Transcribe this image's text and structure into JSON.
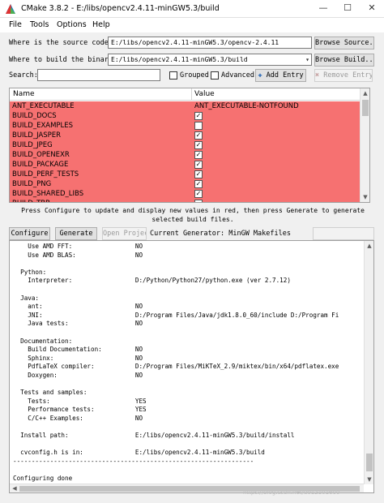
{
  "window": {
    "title": "CMake 3.8.2 - E:/libs/opencv2.4.11-minGW5.3/build",
    "minimize": "—",
    "maximize": "☐",
    "close": "✕"
  },
  "menu": {
    "file": "File",
    "tools": "Tools",
    "options": "Options",
    "help": "Help"
  },
  "source": {
    "label": "Where is the source code:",
    "value": "E:/libs/opencv2.4.11-minGW5.3/opencv-2.4.11",
    "browse": "Browse Source..."
  },
  "build": {
    "label": "Where to build the binaries:",
    "value": "E:/libs/opencv2.4.11-minGW5.3/build",
    "browse": "Browse Build..."
  },
  "search": {
    "label": "Search:",
    "value": "",
    "grouped": "Grouped",
    "advanced": "Advanced",
    "add_entry": "Add Entry",
    "remove_entry": "Remove Entry"
  },
  "table": {
    "col_name": "Name",
    "col_value": "Value",
    "rows": [
      {
        "name": "ANT_EXECUTABLE",
        "value": "ANT_EXECUTABLE-NOTFOUND",
        "checked": false
      },
      {
        "name": "BUILD_DOCS",
        "value": "",
        "checked": true
      },
      {
        "name": "BUILD_EXAMPLES",
        "value": "",
        "checked": false
      },
      {
        "name": "BUILD_JASPER",
        "value": "",
        "checked": true
      },
      {
        "name": "BUILD_JPEG",
        "value": "",
        "checked": true
      },
      {
        "name": "BUILD_OPENEXR",
        "value": "",
        "checked": true
      },
      {
        "name": "BUILD_PACKAGE",
        "value": "",
        "checked": true
      },
      {
        "name": "BUILD_PERF_TESTS",
        "value": "",
        "checked": true
      },
      {
        "name": "BUILD_PNG",
        "value": "",
        "checked": true
      },
      {
        "name": "BUILD_SHARED_LIBS",
        "value": "",
        "checked": true
      },
      {
        "name": "BUILD_TBB",
        "value": "",
        "checked": false
      }
    ]
  },
  "hint": "Press Configure to update and display new values in red, then press Generate to generate selected build files.",
  "actions": {
    "configure": "Configure",
    "generate": "Generate",
    "open_project": "Open Project",
    "current_generator": "Current Generator: MinGW Makefiles"
  },
  "output": [
    "    Use AMD FFT:                 NO",
    "    Use AMD BLAS:                NO",
    "",
    "  Python:",
    "    Interpreter:                 D:/Python/Python27/python.exe (ver 2.7.12)",
    "",
    "  Java:",
    "    ant:                         NO",
    "    JNI:                         D:/Program Files/Java/jdk1.8.0_60/include D:/Program Fi",
    "    Java tests:                  NO",
    "",
    "  Documentation:",
    "    Build Documentation:         NO",
    "    Sphinx:                      NO",
    "    PdfLaTeX compiler:           D:/Program Files/MiKTeX_2.9/miktex/bin/x64/pdflatex.exe",
    "    Doxygen:                     NO",
    "",
    "  Tests and samples:",
    "    Tests:                       YES",
    "    Performance tests:           YES",
    "    C/C++ Examples:              NO",
    "",
    "  Install path:                  E:/libs/opencv2.4.11-minGW5.3/build/install",
    "",
    "  cvconfig.h is in:              E:/libs/opencv2.4.11-minGW5.3/build",
    "-----------------------------------------------------------------",
    "",
    "Configuring done"
  ],
  "watermark": "https://blog.csdn.net/u012101600"
}
